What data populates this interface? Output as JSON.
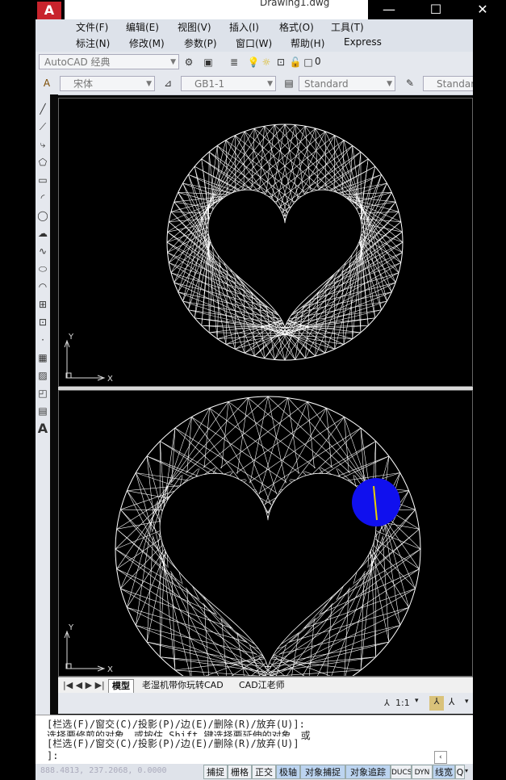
{
  "window": {
    "title": "Drawing1.dwg",
    "logo_letter": "A",
    "minimize_icon": "—",
    "maximize_icon": "☐",
    "close_icon": "✕"
  },
  "menu": {
    "row1": [
      "文件(F)",
      "编辑(E)",
      "视图(V)",
      "插入(I)",
      "格式(O)",
      "工具(T)"
    ],
    "row2": [
      "标注(N)",
      "修改(M)",
      "参数(P)",
      "窗口(W)",
      "帮助(H)",
      "Express"
    ]
  },
  "toolbar1": {
    "workspace": "AutoCAD 经典",
    "layer_number": "0"
  },
  "toolbar2": {
    "text_style": "宋体",
    "dim_style": "GB1-1",
    "table_style": "Standard",
    "multileader_style": "Standard"
  },
  "draw_tools": [
    "line-icon",
    "xline-icon",
    "polyline-icon",
    "polygon-icon",
    "rectangle-icon",
    "arc-icon",
    "circle-icon",
    "revcloud-icon",
    "spline-icon",
    "ellipse-icon",
    "ellipse-arc-icon",
    "insert-block-icon",
    "make-block-icon",
    "point-icon",
    "hatch-icon",
    "gradient-icon",
    "region-icon",
    "table-icon",
    "mtext-icon"
  ],
  "ucs": {
    "x_label": "X",
    "y_label": "Y"
  },
  "tabs": [
    "模型",
    "老湿机带你玩转CAD",
    "CAD江老师"
  ],
  "annotation": {
    "scale": "1:1"
  },
  "command": {
    "line1": "[栏选(F)/窗交(C)/投影(P)/边(E)/删除(R)/放弃(U)]:",
    "line2": "选择要修剪的对象，或按住 Shift 键选择要延伸的对象，或",
    "line3": "[栏选(F)/窗交(C)/投影(P)/边(E)/删除(R)/放弃(U)]",
    "prompt": "]:"
  },
  "status": {
    "coords": "888.4813,  237.2068, 0.0000",
    "buttons": [
      "捕捉",
      "栅格",
      "正交",
      "极轴",
      "对象捕捉",
      "对象追踪",
      "DUCS",
      "DYN",
      "线宽",
      "Q"
    ],
    "active": [
      false,
      false,
      false,
      true,
      true,
      true,
      false,
      false,
      true,
      false
    ]
  },
  "colors": {
    "highlight_circle": "#1010ee",
    "line_color": "#ffffff",
    "accent_yellow": "#e8d000"
  }
}
